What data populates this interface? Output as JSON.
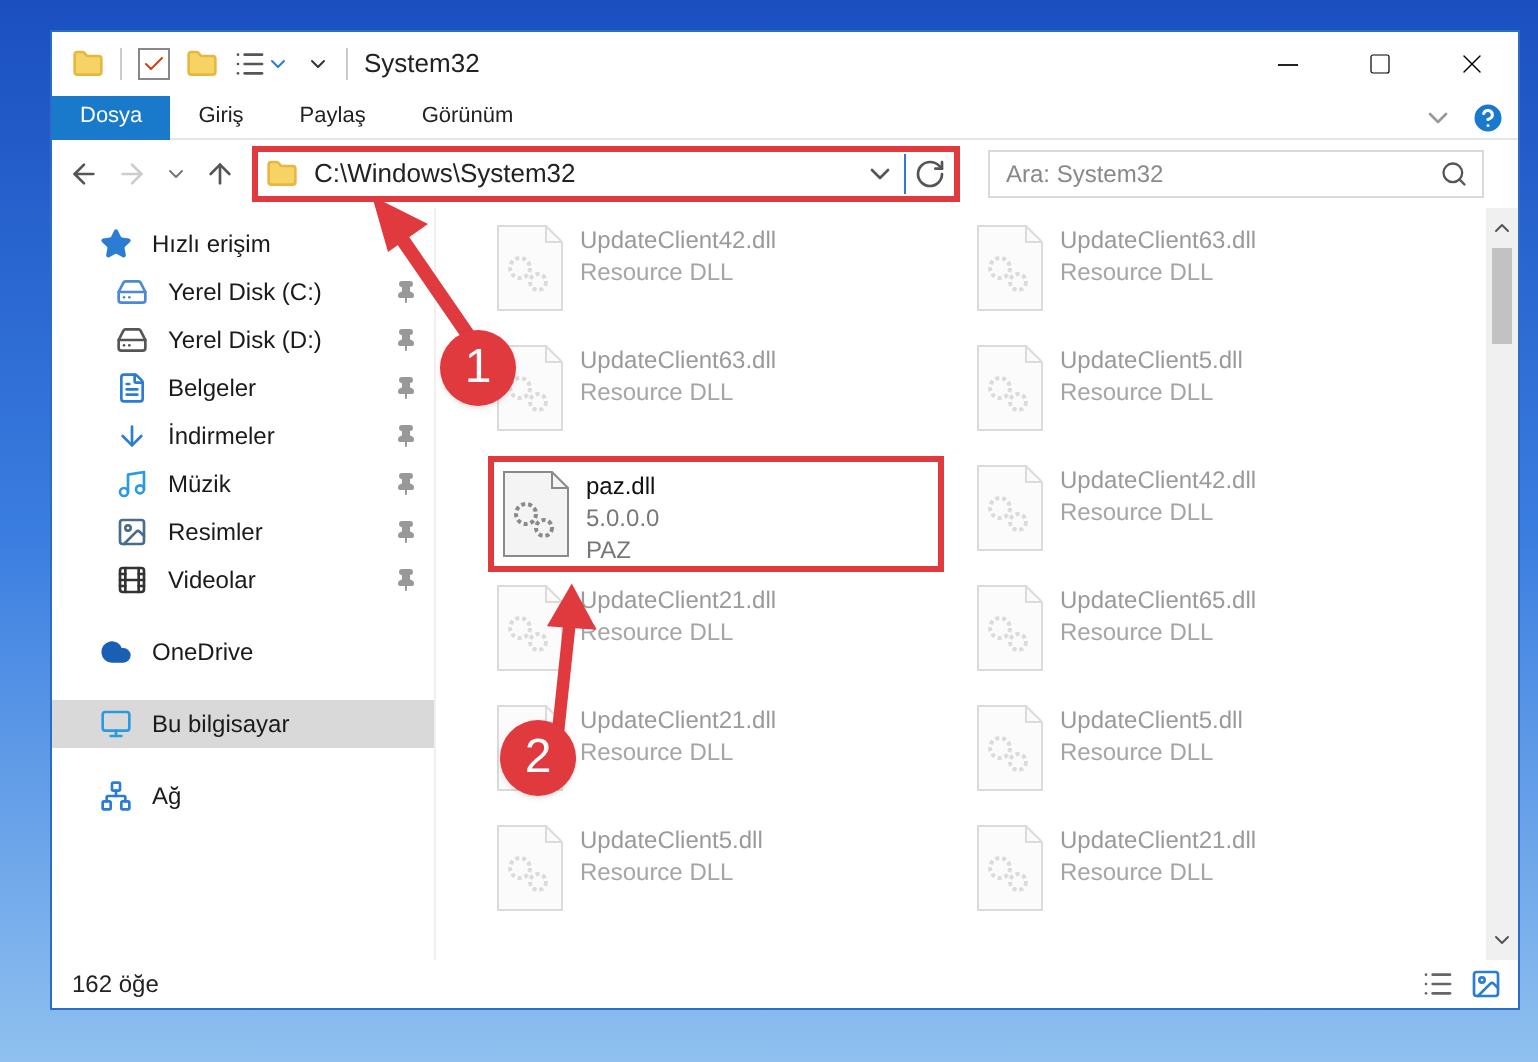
{
  "window": {
    "title": "System32"
  },
  "ribbon_tabs": [
    {
      "label": "Dosya",
      "selected": true
    },
    {
      "label": "Giriş",
      "selected": false
    },
    {
      "label": "Paylaş",
      "selected": false
    },
    {
      "label": "Görünüm",
      "selected": false
    }
  ],
  "address_bar": {
    "path": "C:\\Windows\\System32",
    "highlighted": true
  },
  "search": {
    "placeholder": "Ara: System32"
  },
  "sidebar": {
    "items": [
      {
        "label": "Hızlı erişim",
        "kind": "star",
        "selected": false,
        "children": [
          {
            "label": "Yerel Disk (C:)",
            "kind": "drive-c",
            "pinned": true,
            "selected": false
          },
          {
            "label": "Yerel Disk (D:)",
            "kind": "drive",
            "pinned": true,
            "selected": false
          },
          {
            "label": "Belgeler",
            "kind": "document",
            "pinned": true,
            "selected": false
          },
          {
            "label": "İndirmeler",
            "kind": "download",
            "pinned": true,
            "selected": false
          },
          {
            "label": "Müzik",
            "kind": "music",
            "pinned": true,
            "selected": false
          },
          {
            "label": "Resimler",
            "kind": "picture",
            "pinned": true,
            "selected": false
          },
          {
            "label": "Videolar",
            "kind": "video",
            "pinned": true,
            "selected": false
          }
        ]
      },
      {
        "label": "OneDrive",
        "kind": "cloud",
        "selected": false
      },
      {
        "label": "Bu bilgisayar",
        "kind": "computer",
        "selected": true
      },
      {
        "label": "Ağ",
        "kind": "network",
        "selected": false
      }
    ]
  },
  "files": [
    {
      "name": "UpdateClient42.dll",
      "lines": [
        "Resource DLL"
      ],
      "faded": true,
      "highlighted": false
    },
    {
      "name": "UpdateClient63.dll",
      "lines": [
        "Resource DLL"
      ],
      "faded": true,
      "highlighted": false
    },
    {
      "name": "UpdateClient63.dll",
      "lines": [
        "Resource DLL"
      ],
      "faded": true,
      "highlighted": false
    },
    {
      "name": "UpdateClient5.dll",
      "lines": [
        "Resource DLL"
      ],
      "faded": true,
      "highlighted": false
    },
    {
      "name": "paz.dll",
      "lines": [
        "5.0.0.0",
        "PAZ"
      ],
      "faded": false,
      "highlighted": true
    },
    {
      "name": "UpdateClient42.dll",
      "lines": [
        "Resource DLL"
      ],
      "faded": true,
      "highlighted": false
    },
    {
      "name": "UpdateClient21.dll",
      "lines": [
        "Resource DLL"
      ],
      "faded": true,
      "highlighted": false
    },
    {
      "name": "UpdateClient65.dll",
      "lines": [
        "Resource DLL"
      ],
      "faded": true,
      "highlighted": false
    },
    {
      "name": "UpdateClient21.dll",
      "lines": [
        "Resource DLL"
      ],
      "faded": true,
      "highlighted": false
    },
    {
      "name": "UpdateClient5.dll",
      "lines": [
        "Resource DLL"
      ],
      "faded": true,
      "highlighted": false
    },
    {
      "name": "UpdateClient5.dll",
      "lines": [
        "Resource DLL"
      ],
      "faded": true,
      "highlighted": false
    },
    {
      "name": "UpdateClient21.dll",
      "lines": [
        "Resource DLL"
      ],
      "faded": true,
      "highlighted": false
    }
  ],
  "status_bar": {
    "count": "162 öğe"
  },
  "annotations": [
    {
      "number": "1"
    },
    {
      "number": "2"
    }
  ]
}
